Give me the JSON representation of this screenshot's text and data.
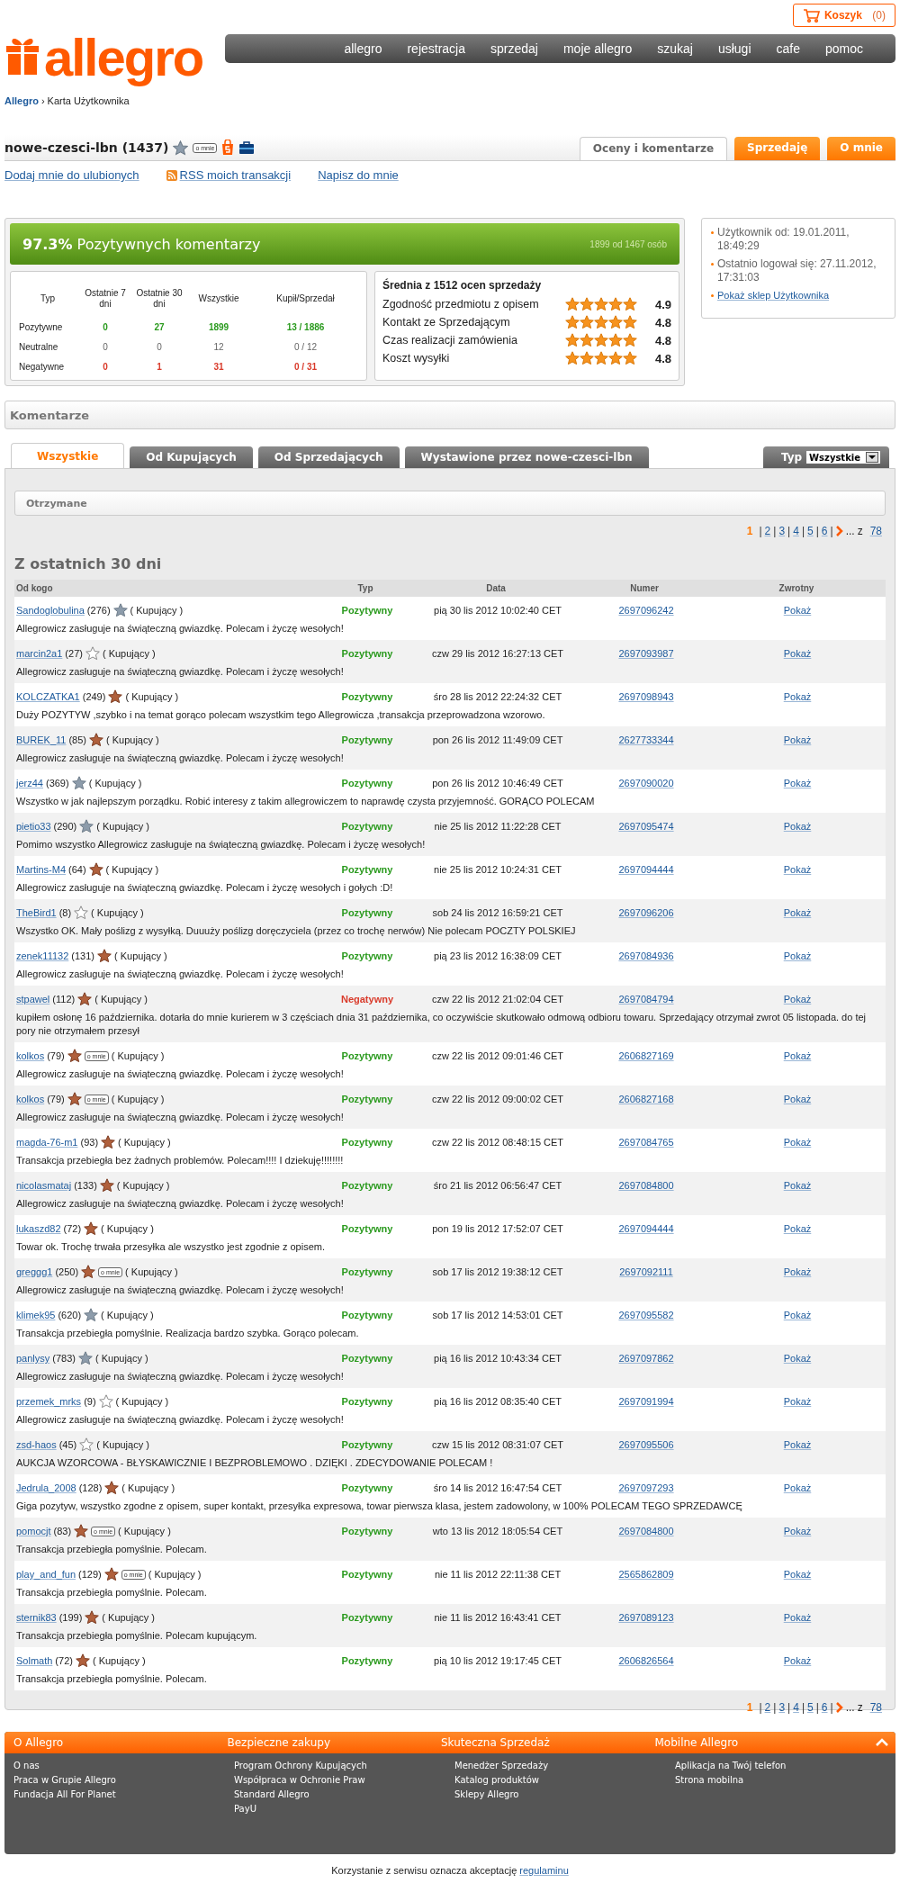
{
  "header": {
    "logo": "allegro",
    "cart": {
      "label": "Koszyk",
      "count": "(0)"
    },
    "nav": [
      "allegro",
      "rejestracja",
      "sprzedaj",
      "moje allegro",
      "szukaj",
      "usługi",
      "cafe",
      "pomoc"
    ]
  },
  "breadcrumb": {
    "home": "Allegro",
    "separator": "›",
    "current": "Karta Użytkownika"
  },
  "user": {
    "name": "nowe-czesci-lbn (1437)",
    "badge": "o mnie"
  },
  "profile_tabs": [
    {
      "label": "Oceny i komentarze",
      "selected": true
    },
    {
      "label": "Sprzedaję",
      "selected": false
    },
    {
      "label": "O mnie",
      "selected": false
    }
  ],
  "actions": [
    "Dodaj mnie do ulubionych",
    "RSS moich transakcji",
    "Napisz do mnie"
  ],
  "summary": {
    "headline": "**97.3%** Pozytywnych komentarzy",
    "sub": "1899 od 1467 osób",
    "columns": [
      "Typ",
      "Ostatnie 7 dni",
      "Ostatnie 30 dni",
      "Wszystkie",
      "Kupił/Sprzedał"
    ],
    "rows": [
      {
        "label": "Pozytywne",
        "kind": "positive",
        "values": [
          "0",
          "27",
          "1899",
          "13 / 1886"
        ]
      },
      {
        "label": "Neutralne",
        "kind": "neutral",
        "values": [
          "0",
          "0",
          "12",
          "0 / 12"
        ]
      },
      {
        "label": "Negatywne",
        "kind": "negative",
        "values": [
          "0",
          "1",
          "31",
          "0 / 31"
        ]
      }
    ],
    "ratings_title": "Średnia z 1512 ocen sprzedaży",
    "ratings": [
      {
        "label": "Zgodność przedmiotu z opisem",
        "stars": 5,
        "value": "4.9"
      },
      {
        "label": "Kontakt ze Sprzedającym",
        "stars": 5,
        "value": "4.8"
      },
      {
        "label": "Czas realizacji zamówienia",
        "stars": 5,
        "value": "4.8"
      },
      {
        "label": "Koszt wysyłki",
        "stars": 5,
        "value": "4.8"
      }
    ]
  },
  "info": {
    "lines": [
      "Użytkownik od: 19.01.2011, 18:49:29",
      "Ostatnio logował się: 27.11.2012, 17:31:03"
    ],
    "link": "Pokaż sklep Użytkownika"
  },
  "comments_title": "Komentarze",
  "comment_tabs": [
    {
      "label": "Wszystkie",
      "selected": true
    },
    {
      "label": "Od Kupujących",
      "selected": false
    },
    {
      "label": "Od Sprzedających",
      "selected": false
    },
    {
      "label": "Wystawione przez nowe-czesci-lbn",
      "selected": false
    }
  ],
  "type_filter": {
    "label": "Typ",
    "value": "Wszystkie"
  },
  "received_title": "Otrzymane",
  "pager_top": {
    "separator": "|",
    "pages": [
      {
        "label": "1",
        "selected": true
      },
      {
        "label": "2",
        "selected": false
      },
      {
        "label": "3",
        "selected": false
      },
      {
        "label": "4",
        "selected": false
      },
      {
        "label": "5",
        "selected": false
      },
      {
        "label": "6",
        "selected": false
      }
    ],
    "ellipsis": "...",
    "of": "z",
    "last": "78"
  },
  "section_title": "Z ostatnich 30 dni",
  "table_columns": [
    "Od kogo",
    "Typ",
    "Data",
    "Numer",
    "Zwrotny"
  ],
  "rows": [
    {
      "user": "Sandoglobulina",
      "score": "(276)",
      "star": {
        "kind": "grey"
      },
      "role": "( Kupujący )",
      "type": {
        "label": "Pozytywny",
        "kind": "positive"
      },
      "date": "pią 30 lis 2012 10:02:40 CET",
      "number": "2697096242",
      "action": "Pokaż",
      "comment": "Allegrowicz zasługuje na świąteczną gwiazdkę. Polecam i życzę wesołych!"
    },
    {
      "user": "marcin2a1",
      "score": "(27)",
      "star": {
        "kind": "white"
      },
      "role": "( Kupujący )",
      "type": {
        "label": "Pozytywny",
        "kind": "positive"
      },
      "date": "czw 29 lis 2012 16:27:13 CET",
      "number": "2697093987",
      "action": "Pokaż",
      "comment": "Allegrowicz zasługuje na świąteczną gwiazdkę. Polecam i życzę wesołych!"
    },
    {
      "user": "KOLCZATKA1",
      "score": "(249)",
      "star": {
        "kind": "brown"
      },
      "role": "( Kupujący )",
      "type": {
        "label": "Pozytywny",
        "kind": "positive"
      },
      "date": "śro 28 lis 2012 22:24:32 CET",
      "number": "2697098943",
      "action": "Pokaż",
      "comment": "Duży POZYTYW ,szybko i na temat gorąco polecam wszystkim tego Allegrowicza ,transakcja przeprowadzona wzorowo."
    },
    {
      "user": "BUREK_11",
      "score": "(85)",
      "star": {
        "kind": "brown"
      },
      "role": "( Kupujący )",
      "type": {
        "label": "Pozytywny",
        "kind": "positive"
      },
      "date": "pon 26 lis 2012 11:49:09 CET",
      "number": "2627733344",
      "action": "Pokaż",
      "comment": "Allegrowicz zasługuje na świąteczną gwiazdkę. Polecam i życzę wesołych!"
    },
    {
      "user": "jerz44",
      "score": "(369)",
      "star": {
        "kind": "grey"
      },
      "role": "( Kupujący )",
      "type": {
        "label": "Pozytywny",
        "kind": "positive"
      },
      "date": "pon 26 lis 2012 10:46:49 CET",
      "number": "2697090020",
      "action": "Pokaż",
      "comment": "Wszystko w jak najlepszym porządku. Robić interesy z takim allegrowiczem to naprawdę czysta przyjemność. GORĄCO POLECAM"
    },
    {
      "user": "pietio33",
      "score": "(290)",
      "star": {
        "kind": "grey"
      },
      "role": "( Kupujący )",
      "type": {
        "label": "Pozytywny",
        "kind": "positive"
      },
      "date": "nie 25 lis 2012 11:22:28 CET",
      "number": "2697095474",
      "action": "Pokaż",
      "comment": "Pomimo wszystko Allegrowicz zasługuje na świąteczną gwiazdkę. Polecam i życzę wesołych!"
    },
    {
      "user": "Martins-M4",
      "score": "(64)",
      "star": {
        "kind": "brown"
      },
      "role": "( Kupujący )",
      "type": {
        "label": "Pozytywny",
        "kind": "positive"
      },
      "date": "nie 25 lis 2012 10:24:31 CET",
      "number": "2697094444",
      "action": "Pokaż",
      "comment": "Allegrowicz zasługuje na świąteczną gwiazdkę. Polecam i życzę wesołych i gołych :D!"
    },
    {
      "user": "TheBird1",
      "score": "(8)",
      "star": {
        "kind": "white"
      },
      "role": "( Kupujący )",
      "type": {
        "label": "Pozytywny",
        "kind": "positive"
      },
      "date": "sob 24 lis 2012 16:59:21 CET",
      "number": "2697096206",
      "action": "Pokaż",
      "comment": "Wszystko OK. Mały poślizg z wysyłką. Duuuży poślizg doręczyciela (przez co trochę nerwów) Nie polecam POCZTY POLSKIEJ"
    },
    {
      "user": "zenek11132",
      "score": "(131)",
      "star": {
        "kind": "brown"
      },
      "role": "( Kupujący )",
      "type": {
        "label": "Pozytywny",
        "kind": "positive"
      },
      "date": "pią 23 lis 2012 16:38:09 CET",
      "number": "2697084936",
      "action": "Pokaż",
      "comment": "Allegrowicz zasługuje na świąteczną gwiazdkę. Polecam i życzę wesołych!"
    },
    {
      "user": "stpawel",
      "score": "(112)",
      "star": {
        "kind": "brown"
      },
      "role": "( Kupujący )",
      "type": {
        "label": "Negatywny",
        "kind": "negative"
      },
      "date": "czw 22 lis 2012 21:02:04 CET",
      "number": "2697084794",
      "action": "Pokaż",
      "comment": "kupiłem osłonę 16 października. dotarła do mnie kurierem w 3 częściach dnia 31 października, co oczywiście skutkowało odmową odbioru towaru. Sprzedający otrzymał zwrot 05 listopada. do tej pory nie otrzymałem przesył"
    },
    {
      "user": "kolkos",
      "score": "(79)",
      "star": {
        "kind": "brown"
      },
      "badge": "o mnie",
      "role": "( Kupujący )",
      "type": {
        "label": "Pozytywny",
        "kind": "positive"
      },
      "date": "czw 22 lis 2012 09:01:46 CET",
      "number": "2606827169",
      "action": "Pokaż",
      "comment": "Allegrowicz zasługuje na świąteczną gwiazdkę. Polecam i życzę wesołych!"
    },
    {
      "user": "kolkos",
      "score": "(79)",
      "star": {
        "kind": "brown"
      },
      "badge": "o mnie",
      "role": "( Kupujący )",
      "type": {
        "label": "Pozytywny",
        "kind": "positive"
      },
      "date": "czw 22 lis 2012 09:00:02 CET",
      "number": "2606827168",
      "action": "Pokaż",
      "comment": "Allegrowicz zasługuje na świąteczną gwiazdkę. Polecam i życzę wesołych!"
    },
    {
      "user": "magda-76-m1",
      "score": "(93)",
      "star": {
        "kind": "brown"
      },
      "role": "( Kupujący )",
      "type": {
        "label": "Pozytywny",
        "kind": "positive"
      },
      "date": "czw 22 lis 2012 08:48:15 CET",
      "number": "2697084765",
      "action": "Pokaż",
      "comment": "Transakcja przebiegła bez żadnych problemów. Polecam!!!! I dziekuję!!!!!!!!"
    },
    {
      "user": "nicolasmataj",
      "score": "(133)",
      "star": {
        "kind": "brown"
      },
      "role": "( Kupujący )",
      "type": {
        "label": "Pozytywny",
        "kind": "positive"
      },
      "date": "śro 21 lis 2012 06:56:47 CET",
      "number": "2697084800",
      "action": "Pokaż",
      "comment": "Allegrowicz zasługuje na świąteczną gwiazdkę. Polecam i życzę wesołych!"
    },
    {
      "user": "lukaszd82",
      "score": "(72)",
      "star": {
        "kind": "brown"
      },
      "role": "( Kupujący )",
      "type": {
        "label": "Pozytywny",
        "kind": "positive"
      },
      "date": "pon 19 lis 2012 17:52:07 CET",
      "number": "2697094444",
      "action": "Pokaż",
      "comment": "Towar ok. Trochę trwała przesyłka ale wszystko jest zgodnie z opisem."
    },
    {
      "user": "greggg1",
      "score": "(250)",
      "star": {
        "kind": "brown"
      },
      "badge": "o mnie",
      "role": "( Kupujący )",
      "type": {
        "label": "Pozytywny",
        "kind": "positive"
      },
      "date": "sob 17 lis 2012 19:38:12 CET",
      "number": "2697092111",
      "action": "Pokaż",
      "comment": "Allegrowicz zasługuje na świąteczną gwiazdkę. Polecam i życzę wesołych!"
    },
    {
      "user": "klimek95",
      "score": "(620)",
      "star": {
        "kind": "grey"
      },
      "role": "( Kupujący )",
      "type": {
        "label": "Pozytywny",
        "kind": "positive"
      },
      "date": "sob 17 lis 2012 14:53:01 CET",
      "number": "2697095582",
      "action": "Pokaż",
      "comment": "Transakcja przebiegła pomyślnie. Realizacja bardzo szybka. Gorąco polecam."
    },
    {
      "user": "panlysy",
      "score": "(783)",
      "star": {
        "kind": "grey"
      },
      "role": "( Kupujący )",
      "type": {
        "label": "Pozytywny",
        "kind": "positive"
      },
      "date": "pią 16 lis 2012 10:43:34 CET",
      "number": "2697097862",
      "action": "Pokaż",
      "comment": "Allegrowicz zasługuje na świąteczną gwiazdkę. Polecam i życzę wesołych!"
    },
    {
      "user": "przemek_mrks",
      "score": "(9)",
      "star": {
        "kind": "white"
      },
      "role": "( Kupujący )",
      "type": {
        "label": "Pozytywny",
        "kind": "positive"
      },
      "date": "pią 16 lis 2012 08:35:40 CET",
      "number": "2697091994",
      "action": "Pokaż",
      "comment": "Allegrowicz zasługuje na świąteczną gwiazdkę. Polecam i życzę wesołych!"
    },
    {
      "user": "zsd-haos",
      "score": "(45)",
      "star": {
        "kind": "white"
      },
      "role": "( Kupujący )",
      "type": {
        "label": "Pozytywny",
        "kind": "positive"
      },
      "date": "czw 15 lis 2012 08:31:07 CET",
      "number": "2697095506",
      "action": "Pokaż",
      "comment": "AUKCJA WZORCOWA - BŁYSKAWICZNIE I BEZPROBLEMOWO . DZIĘKI . ZDECYDOWANIE POLECAM !"
    },
    {
      "user": "Jedrula_2008",
      "score": "(128)",
      "star": {
        "kind": "brown"
      },
      "role": "( Kupujący )",
      "type": {
        "label": "Pozytywny",
        "kind": "positive"
      },
      "date": "śro 14 lis 2012 16:47:54 CET",
      "number": "2697097293",
      "action": "Pokaż",
      "comment": "Giga pozytyw, wszystko zgodne z opisem, super kontakt, przesyłka expresowa, towar pierwsza klasa, jestem zadowolony, w 100% POLECAM TEGO SPRZEDAWCĘ"
    },
    {
      "user": "pomocjt",
      "score": "(83)",
      "star": {
        "kind": "brown"
      },
      "badge": "o mnie",
      "role": "( Kupujący )",
      "type": {
        "label": "Pozytywny",
        "kind": "positive"
      },
      "date": "wto 13 lis 2012 18:05:54 CET",
      "number": "2697084800",
      "action": "Pokaż",
      "comment": "Transakcja przebiegła pomyślnie. Polecam."
    },
    {
      "user": "play_and_fun",
      "score": "(129)",
      "star": {
        "kind": "brown"
      },
      "badge": "o mnie",
      "role": "( Kupujący )",
      "type": {
        "label": "Pozytywny",
        "kind": "positive"
      },
      "date": "nie 11 lis 2012 22:11:38 CET",
      "number": "2565862809",
      "action": "Pokaż",
      "comment": "Transakcja przebiegła pomyślnie. Polecam."
    },
    {
      "user": "sternik83",
      "score": "(199)",
      "star": {
        "kind": "brown"
      },
      "role": "( Kupujący )",
      "type": {
        "label": "Pozytywny",
        "kind": "positive"
      },
      "date": "nie 11 lis 2012 16:43:41 CET",
      "number": "2697089123",
      "action": "Pokaż",
      "comment": "Transakcja przebiegła pomyślnie. Polecam kupującym."
    },
    {
      "user": "Solmath",
      "score": "(72)",
      "star": {
        "kind": "brown"
      },
      "role": "( Kupujący )",
      "type": {
        "label": "Pozytywny",
        "kind": "positive"
      },
      "date": "pią 10 lis 2012 19:17:45 CET",
      "number": "2606826564",
      "action": "Pokaż",
      "comment": "Transakcja przebiegła pomyślnie. Polecam."
    }
  ],
  "pager_bottom": {
    "separator": "|",
    "pages": [
      {
        "label": "1",
        "selected": true
      },
      {
        "label": "2",
        "selected": false
      },
      {
        "label": "3",
        "selected": false
      },
      {
        "label": "4",
        "selected": false
      },
      {
        "label": "5",
        "selected": false
      },
      {
        "label": "6",
        "selected": false
      }
    ],
    "ellipsis": "...",
    "of": "z",
    "last": "78"
  },
  "footer": {
    "columns": [
      {
        "title": "O Allegro",
        "links": [
          "O nas",
          "Praca w Grupie Allegro",
          "Fundacja All For Planet"
        ]
      },
      {
        "title": "Bezpieczne zakupy",
        "links": [
          "Program Ochrony Kupujących",
          "Współpraca w Ochronie Praw",
          "Standard Allegro",
          "PayU"
        ]
      },
      {
        "title": "Skuteczna Sprzedaż",
        "links": [
          "Menedżer Sprzedaży",
          "Katalog produktów",
          "Sklepy Allegro"
        ]
      },
      {
        "title": "Mobilne Allegro",
        "links": [
          "Aplikacja na Twój telefon",
          "Strona mobilna"
        ]
      }
    ],
    "terms": "Korzystanie z serwisu oznacza akceptację",
    "terms_link": "regulaminu"
  }
}
